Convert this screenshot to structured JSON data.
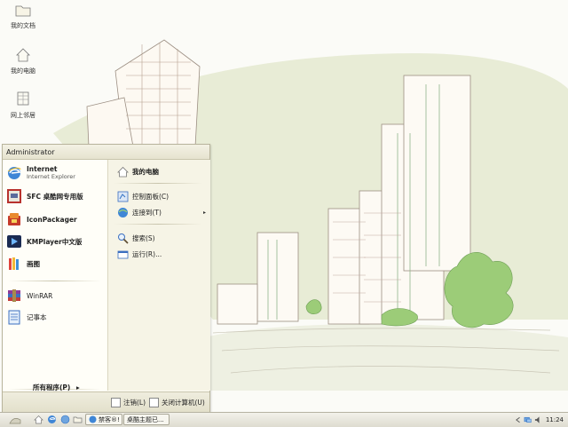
{
  "desktop": {
    "icons": [
      {
        "label": "我的文档",
        "icon": "folder-icon"
      },
      {
        "label": "我的电脑",
        "icon": "house-icon"
      },
      {
        "label": "网上邻居",
        "icon": "network-icon"
      }
    ]
  },
  "start_menu": {
    "user": "Administrator",
    "pinned": [
      {
        "title": "Internet",
        "subtitle": "Internet Explorer",
        "icon": "ie-icon"
      },
      {
        "title": "SFC 桌酷网专用版",
        "icon": "sfc-icon"
      },
      {
        "title": "IconPackager",
        "icon": "iconpackager-icon"
      },
      {
        "title": "KMPlayer中文版",
        "icon": "kmplayer-icon"
      },
      {
        "title": "画图",
        "icon": "paint-icon"
      }
    ],
    "recent": [
      {
        "title": "WinRAR",
        "icon": "winrar-icon"
      },
      {
        "title": "记事本",
        "icon": "notepad-icon"
      }
    ],
    "all_programs": "所有程序(P)",
    "all_programs_arrow": "▸",
    "right": {
      "my_computer": "我的电脑",
      "control_panel": "控制面板(C)",
      "connect_to": "连接到(T)",
      "search": "搜索(S)",
      "run": "运行(R)...",
      "submenu_arrow": "▸"
    },
    "footer": {
      "logoff": "注销(L)",
      "shutdown": "关闭计算机(U)"
    }
  },
  "taskbar": {
    "tasks": [
      {
        "label": "禁客®! ",
        "icon": "ie-icon"
      },
      {
        "label": "桌酷主题已...",
        "icon": "theme-icon"
      }
    ],
    "clock": "11:24"
  },
  "colors": {
    "accent_blue": "#2f6fc3",
    "menu_bg": "#fdfcf3",
    "wallpaper_green": "#e6ead2"
  }
}
